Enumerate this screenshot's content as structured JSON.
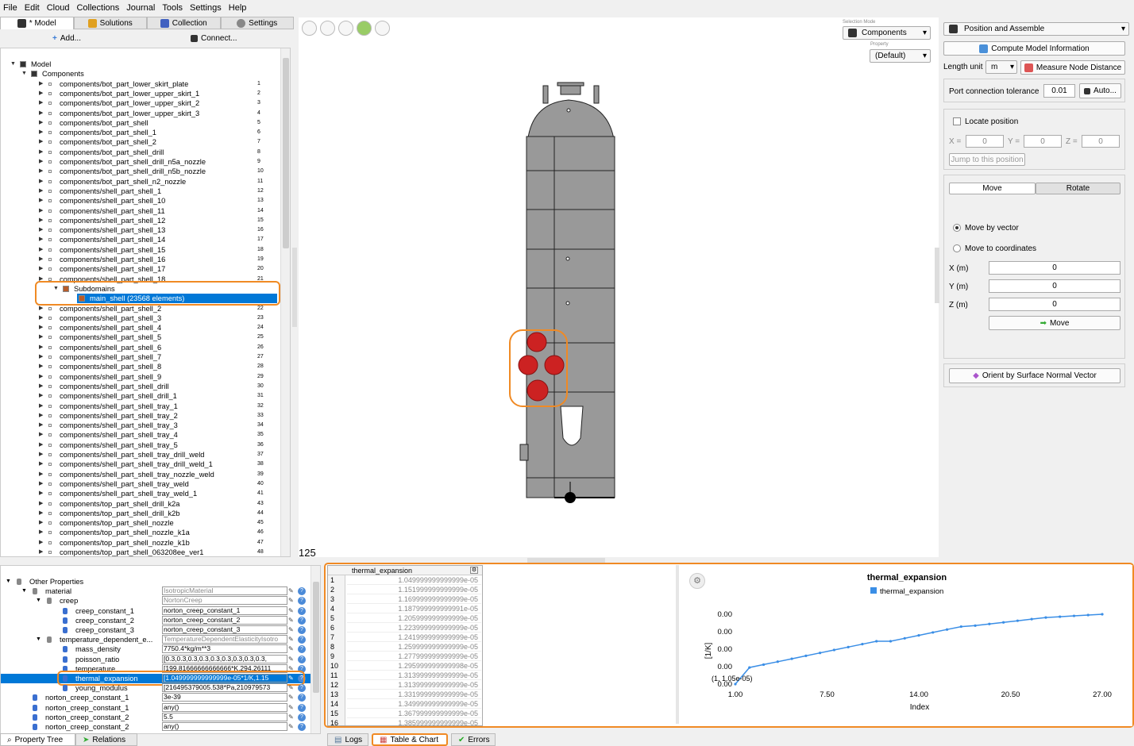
{
  "menu": [
    "File",
    "Edit",
    "Cloud",
    "Collections",
    "Journal",
    "Tools",
    "Settings",
    "Help"
  ],
  "left_tabs": [
    {
      "label": "* Model",
      "color": "#333"
    },
    {
      "label": "Solutions",
      "color": "#e0a020"
    },
    {
      "label": "Collection",
      "color": "#4060c0"
    },
    {
      "label": "Settings",
      "color": "#888"
    }
  ],
  "left_toolbar": {
    "add": "Add...",
    "connect": "Connect..."
  },
  "tree": {
    "root": "Model",
    "components_label": "Components",
    "items": [
      {
        "label": "components/bot_part_lower_skirt_plate",
        "num": "1"
      },
      {
        "label": "components/bot_part_lower_upper_skirt_1",
        "num": "2"
      },
      {
        "label": "components/bot_part_lower_upper_skirt_2",
        "num": "3"
      },
      {
        "label": "components/bot_part_lower_upper_skirt_3",
        "num": "4"
      },
      {
        "label": "components/bot_part_shell",
        "num": "5"
      },
      {
        "label": "components/bot_part_shell_1",
        "num": "6"
      },
      {
        "label": "components/bot_part_shell_2",
        "num": "7"
      },
      {
        "label": "components/bot_part_shell_drill",
        "num": "8"
      },
      {
        "label": "components/bot_part_shell_drill_n5a_nozzle",
        "num": "9"
      },
      {
        "label": "components/bot_part_shell_drill_n5b_nozzle",
        "num": "10"
      },
      {
        "label": "components/bot_part_shell_n2_nozzle",
        "num": "11"
      },
      {
        "label": "components/shell_part_shell_1",
        "num": "12"
      },
      {
        "label": "components/shell_part_shell_10",
        "num": "13"
      },
      {
        "label": "components/shell_part_shell_11",
        "num": "14"
      },
      {
        "label": "components/shell_part_shell_12",
        "num": "15"
      },
      {
        "label": "components/shell_part_shell_13",
        "num": "16"
      },
      {
        "label": "components/shell_part_shell_14",
        "num": "17"
      },
      {
        "label": "components/shell_part_shell_15",
        "num": "18"
      },
      {
        "label": "components/shell_part_shell_16",
        "num": "19"
      },
      {
        "label": "components/shell_part_shell_17",
        "num": "20"
      },
      {
        "label": "components/shell_part_shell_18",
        "num": "21"
      }
    ],
    "subdomains_label": "Subdomains",
    "subdomain_item": "main_shell (23568 elements)",
    "items2": [
      {
        "label": "components/shell_part_shell_2",
        "num": "22"
      },
      {
        "label": "components/shell_part_shell_3",
        "num": "23"
      },
      {
        "label": "components/shell_part_shell_4",
        "num": "24"
      },
      {
        "label": "components/shell_part_shell_5",
        "num": "25"
      },
      {
        "label": "components/shell_part_shell_6",
        "num": "26"
      },
      {
        "label": "components/shell_part_shell_7",
        "num": "27"
      },
      {
        "label": "components/shell_part_shell_8",
        "num": "28"
      },
      {
        "label": "components/shell_part_shell_9",
        "num": "29"
      },
      {
        "label": "components/shell_part_shell_drill",
        "num": "30"
      },
      {
        "label": "components/shell_part_shell_drill_1",
        "num": "31"
      },
      {
        "label": "components/shell_part_shell_tray_1",
        "num": "32"
      },
      {
        "label": "components/shell_part_shell_tray_2",
        "num": "33"
      },
      {
        "label": "components/shell_part_shell_tray_3",
        "num": "34"
      },
      {
        "label": "components/shell_part_shell_tray_4",
        "num": "35"
      },
      {
        "label": "components/shell_part_shell_tray_5",
        "num": "36"
      },
      {
        "label": "components/shell_part_shell_tray_drill_weld",
        "num": "37"
      },
      {
        "label": "components/shell_part_shell_tray_drill_weld_1",
        "num": "38"
      },
      {
        "label": "components/shell_part_shell_tray_nozzle_weld",
        "num": "39"
      },
      {
        "label": "components/shell_part_shell_tray_weld",
        "num": "40"
      },
      {
        "label": "components/shell_part_shell_tray_weld_1",
        "num": "41"
      },
      {
        "label": "components/top_part_shell_drill_k2a",
        "num": "43"
      },
      {
        "label": "components/top_part_shell_drill_k2b",
        "num": "44"
      },
      {
        "label": "components/top_part_shell_nozzle",
        "num": "45"
      },
      {
        "label": "components/top_part_shell_nozzle_k1a",
        "num": "46"
      },
      {
        "label": "components/top_part_shell_nozzle_k1b",
        "num": "47"
      },
      {
        "label": "components/top_part_shell_063208ee_ver1",
        "num": "48"
      }
    ]
  },
  "viewport": {
    "selection_mode_caption": "Selection Mode",
    "selection_mode": "Components",
    "property_caption": "Property",
    "property": "(Default)",
    "counter": "125"
  },
  "right": {
    "position_assemble": "Position and Assemble",
    "compute_info": "Compute Model Information",
    "length_unit_label": "Length unit",
    "length_unit": "m",
    "measure": "Measure Node Distance",
    "port_tol_label": "Port connection tolerance",
    "port_tol": "0.01",
    "auto": "Auto...",
    "locate_label": "Locate position",
    "x_lbl": "X =",
    "y_lbl": "Y =",
    "z_lbl": "Z =",
    "x_val": "0",
    "y_val": "0",
    "z_val": "0",
    "jump": "Jump to this position",
    "move_tab": "Move",
    "rotate_tab": "Rotate",
    "move_vector": "Move by vector",
    "move_coords": "Move to coordinates",
    "xm": "X (m)",
    "ym": "Y (m)",
    "zm": "Z (m)",
    "xm_val": "0",
    "ym_val": "0",
    "zm_val": "0",
    "move_btn": "Move",
    "orient": "Orient by Surface Normal Vector"
  },
  "props": {
    "other": "Other Properties",
    "material": "material",
    "material_val": "IsotropicMaterial",
    "creep": "creep",
    "creep_val": "NortonCreep",
    "cc1": "creep_constant_1",
    "cc1_val": "norton_creep_constant_1",
    "cc2": "creep_constant_2",
    "cc2_val": "norton_creep_constant_2",
    "cc3": "creep_constant_3",
    "cc3_val": "norton_creep_constant_3",
    "tde": "temperature_dependent_e...",
    "tde_val": "TemperatureDependentElasticityIsotro",
    "md": "mass_density",
    "md_val": "7750.4*kg/m**3",
    "pr": "poisson_ratio",
    "pr_val": "[0.3,0.3,0.3,0.3,0.3,0.3,0.3,0.3,0.3,",
    "temp": "temperature",
    "temp_val": "[199.81666666666666*K,294.26111",
    "te": "thermal_expansion",
    "te_val": "[1.049999999999999e-05*1/K,1.15",
    "ym": "young_modulus",
    "ym_val": "[216495379005.538*Pa,210979573",
    "n1": "norton_creep_constant_1",
    "n1_val": "3e-39",
    "n2": "norton_creep_constant_1",
    "n2_val": "any()",
    "n3": "norton_creep_constant_2",
    "n3_val": "5.5",
    "n4": "norton_creep_constant_2",
    "n4_val": "any()"
  },
  "bottom_tabs_left": [
    "Property Tree",
    "Relations"
  ],
  "table": {
    "header": "thermal_expansion",
    "rows": [
      {
        "i": "1",
        "v": "1.049999999999999e-05"
      },
      {
        "i": "2",
        "v": "1.151999999999999e-05"
      },
      {
        "i": "3",
        "v": "1.169999999999999e-05"
      },
      {
        "i": "4",
        "v": "1.187999999999991e-05"
      },
      {
        "i": "5",
        "v": "1.205999999999999e-05"
      },
      {
        "i": "6",
        "v": "1.223999999999999e-05"
      },
      {
        "i": "7",
        "v": "1.241999999999999e-05"
      },
      {
        "i": "8",
        "v": "1.259999999999999e-05"
      },
      {
        "i": "9",
        "v": "1.277999999999999e-05"
      },
      {
        "i": "10",
        "v": "1.295999999999998e-05"
      },
      {
        "i": "11",
        "v": "1.313999999999999e-05"
      },
      {
        "i": "12",
        "v": "1.313999999999999e-05"
      },
      {
        "i": "13",
        "v": "1.331999999999999e-05"
      },
      {
        "i": "14",
        "v": "1.349999999999999e-05"
      },
      {
        "i": "15",
        "v": "1.367999999999999e-05"
      },
      {
        "i": "16",
        "v": "1.385999999999999e-05"
      }
    ]
  },
  "bottom_tabs_right": [
    "Logs",
    "Table & Chart",
    "Errors"
  ],
  "chart_data": {
    "type": "line",
    "title": "thermal_expansion",
    "legend": "top-center",
    "series": [
      {
        "name": "thermal_expansion",
        "color": "#3a8ee6"
      }
    ],
    "xlabel": "Index",
    "ylabel": "[1/K]",
    "xticks": [
      "1.00",
      "7.50",
      "14.00",
      "20.50",
      "27.00"
    ],
    "yticks": [
      "0.00",
      "0.00",
      "0.00",
      "0.00",
      "0.00"
    ],
    "xlim": [
      1,
      27
    ],
    "x": [
      1,
      2,
      3,
      4,
      5,
      6,
      7,
      8,
      9,
      10,
      11,
      12,
      13,
      14,
      15,
      16,
      17,
      18,
      19,
      20,
      21,
      22,
      23,
      24,
      25,
      26,
      27
    ],
    "y": [
      1.05e-05,
      1.152e-05,
      1.17e-05,
      1.188e-05,
      1.206e-05,
      1.224e-05,
      1.242e-05,
      1.26e-05,
      1.278e-05,
      1.296e-05,
      1.314e-05,
      1.314e-05,
      1.332e-05,
      1.35e-05,
      1.368e-05,
      1.386e-05,
      1.404e-05,
      1.41e-05,
      1.42e-05,
      1.43e-05,
      1.44e-05,
      1.45e-05,
      1.46e-05,
      1.465e-05,
      1.47e-05,
      1.475e-05,
      1.48e-05
    ],
    "first_point_label": "(1, 1.05e-05)"
  }
}
